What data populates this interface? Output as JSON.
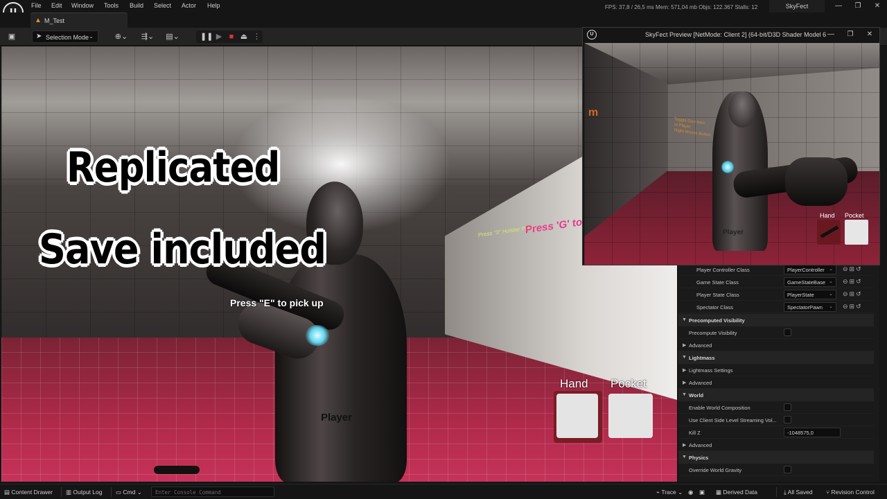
{
  "menu": [
    "File",
    "Edit",
    "Window",
    "Tools",
    "Build",
    "Select",
    "Actor",
    "Help"
  ],
  "perf": {
    "fps_label": "FPS:",
    "fps": "37,8",
    "ms": "/ 26,5 ms",
    "mem_label": "Mem:",
    "mem": "571,04 mb",
    "objs_label": "Objs:",
    "objs": "122.367",
    "stalls_label": "Stalls:",
    "stalls": "12"
  },
  "project": "SkyFect",
  "window_controls": {
    "minimize": "—",
    "maximize": "❐",
    "close": "✕"
  },
  "map_tab": "M_Test",
  "toolbar": {
    "selection_mode": "Selection Mode"
  },
  "viewport": {
    "overlay_line1": "Replicated",
    "overlay_line2": "Save included",
    "pickup_prompt": "Press \"E\" to pick up",
    "player_label": "Player",
    "wall_text_small": "Press \"3\" Holster Pawn",
    "wall_text_big": "Press 'G' to Drop",
    "inventory": {
      "hand_label": "Hand",
      "pocket_label": "Pocket"
    }
  },
  "preview": {
    "title": "SkyFect Preview [NetMode: Client 2]  (64-bit/D3D Shader Model 6",
    "wall_letter": "m",
    "wall_text": "Toggle Gun Item\nto Player\nRight Mouse Button",
    "player_label": "Player",
    "hand_label": "Hand",
    "pocket_label": "Pocket"
  },
  "details": {
    "class_rows": [
      {
        "label": "Player Controller Class",
        "value": "PlayerController"
      },
      {
        "label": "Game State Class",
        "value": "GameStateBase"
      },
      {
        "label": "Player State Class",
        "value": "PlayerState"
      },
      {
        "label": "Spectator Class",
        "value": "SpectatorPawn"
      }
    ],
    "sections": {
      "precomputed": "Precomputed Visibility",
      "precompute_visibility": "Precompute Visibility",
      "advanced": "Advanced",
      "lightmass": "Lightmass",
      "lightmass_settings": "Lightmass Settings",
      "world": "World",
      "enable_world_composition": "Enable World Composition",
      "client_side_streaming": "Use Client Side Level Streaming Vol...",
      "kill_z": "Kill Z",
      "kill_z_value": "-1048575,0",
      "physics": "Physics",
      "override_gravity": "Override World Gravity"
    }
  },
  "statusbar": {
    "content_drawer": "Content Drawer",
    "output_log": "Output Log",
    "cmd": "Cmd",
    "console_placeholder": "Enter Console Command",
    "trace": "Trace",
    "derived_data": "Derived Data",
    "all_saved": "All Saved",
    "revision_control": "Revision Control"
  }
}
